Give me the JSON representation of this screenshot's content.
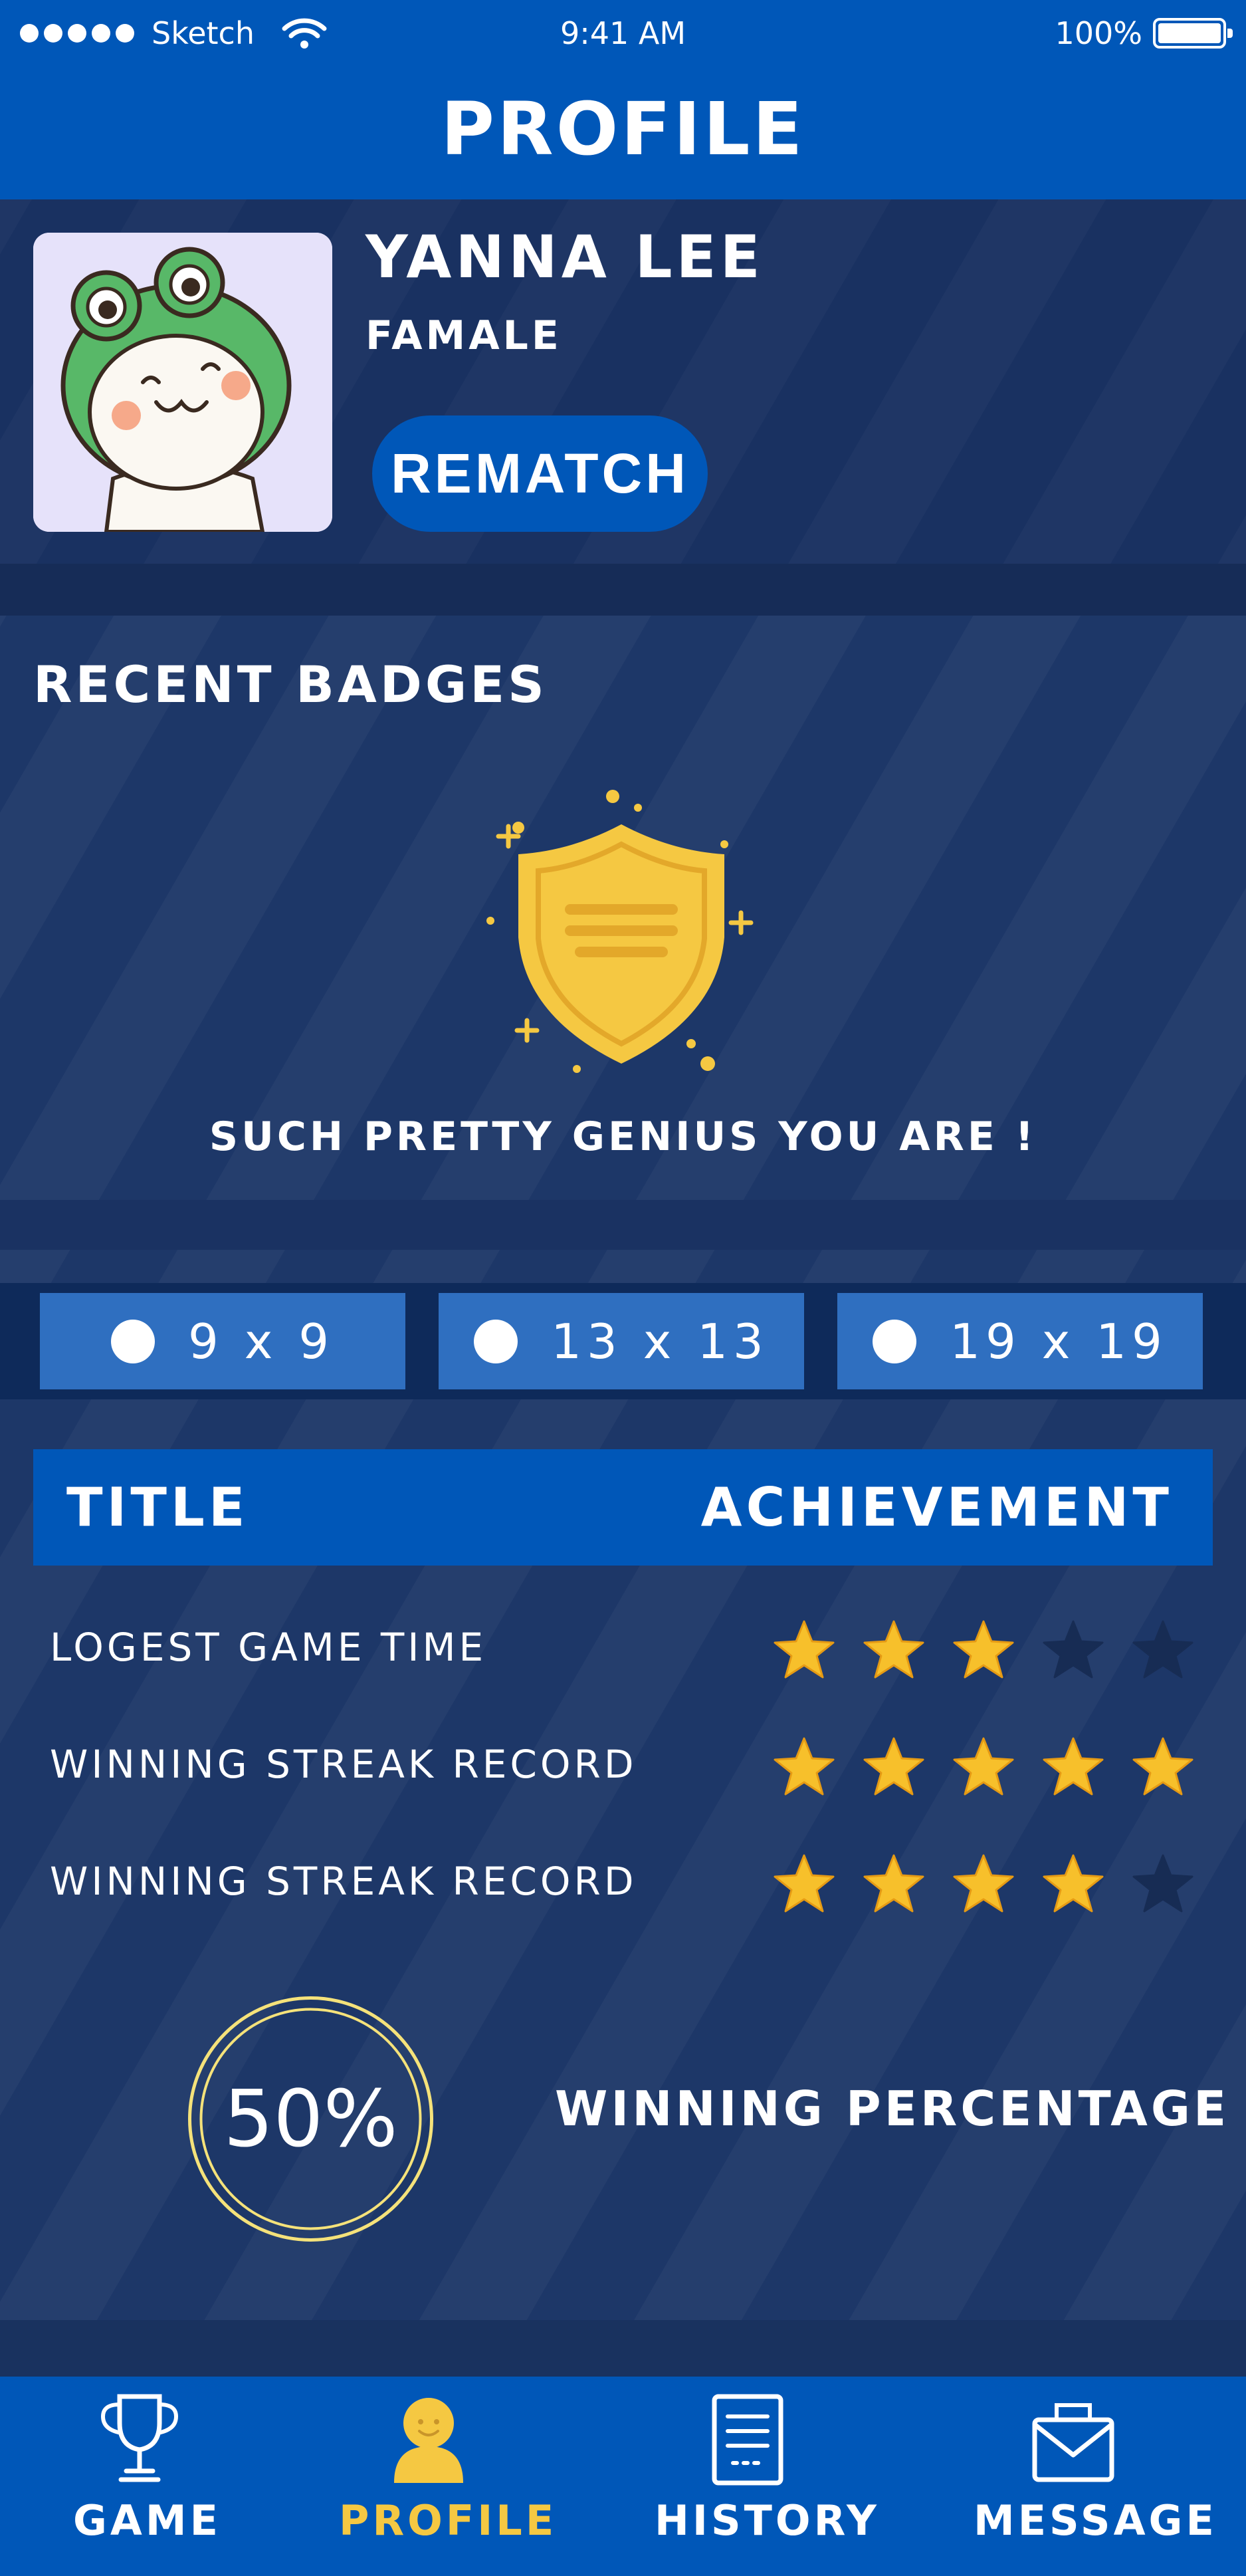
{
  "status_bar": {
    "carrier": "Sketch",
    "time": "9:41 AM",
    "battery": "100%"
  },
  "header": {
    "title": "PROFILE"
  },
  "profile": {
    "name": "YANNA LEE",
    "gender": "FAMALE",
    "rematch_label": "REMATCH"
  },
  "badges": {
    "title": "RECENT BADGES",
    "caption": "SUCH PRETTY GENIUS YOU ARE !",
    "badge_icon": "shield-badge-icon"
  },
  "board_sizes": [
    {
      "label": "9 x 9"
    },
    {
      "label": "13 x 13"
    },
    {
      "label": "19 x 19"
    }
  ],
  "achievements": {
    "header_title": "TITLE",
    "header_achievement": "ACHIEVEMENT",
    "rows": [
      {
        "label": "LOGEST GAME TIME",
        "stars": 3,
        "max": 5
      },
      {
        "label": "WINNING STREAK RECORD",
        "stars": 5,
        "max": 5
      },
      {
        "label": "WINNING STREAK RECORD",
        "stars": 4,
        "max": 5
      }
    ]
  },
  "winning": {
    "value": "50%",
    "label": "WINNING PERCENTAGE",
    "fraction": 0.5
  },
  "nav": {
    "items": [
      {
        "label": "GAME",
        "icon": "trophy-icon",
        "active": false
      },
      {
        "label": "PROFILE",
        "icon": "person-icon",
        "active": true
      },
      {
        "label": "HISTORY",
        "icon": "document-icon",
        "active": false
      },
      {
        "label": "MESSAGE",
        "icon": "envelope-icon",
        "active": false
      }
    ]
  },
  "colors": {
    "primary": "#0057b8",
    "background": "#1d3768",
    "accent": "#f5c842",
    "tab": "#2f6fc0"
  }
}
